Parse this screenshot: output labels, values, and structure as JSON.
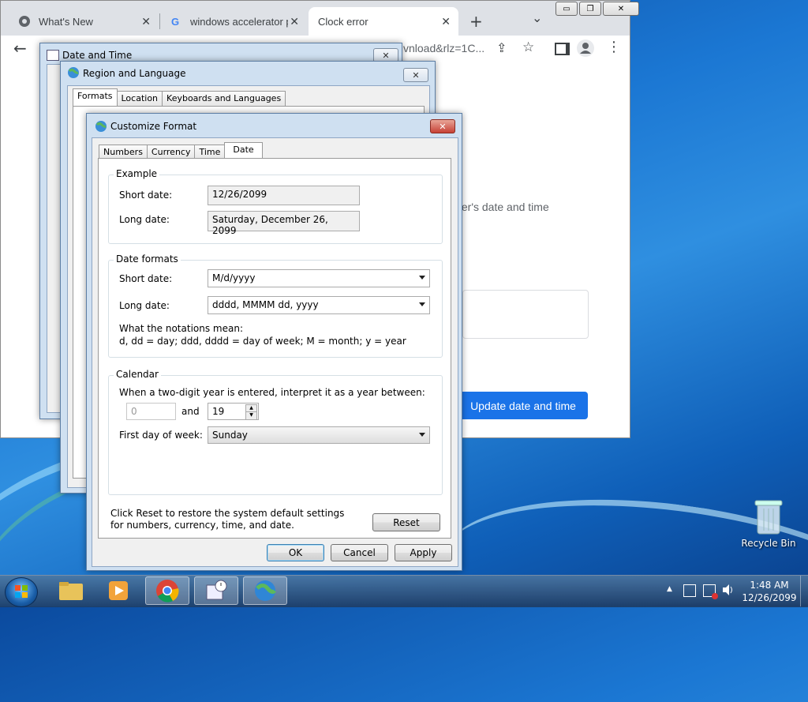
{
  "browser": {
    "tabs": [
      {
        "label": "What's New"
      },
      {
        "label": "windows accelerator pr"
      },
      {
        "label": "Clock error"
      }
    ],
    "address_fragment": "vnload&rlz=1C...",
    "body_text": "ter's date and time",
    "update_button": "Update date and time",
    "new_tab": "+",
    "tab_close": "✕",
    "tab_list": "⌄",
    "window_controls": {
      "minimize": "▭",
      "restore": "❐",
      "close": "✕"
    },
    "nav_back": "←",
    "share": "⇪",
    "star": "☆",
    "menu": "⋮"
  },
  "date_time_dialog": {
    "title": "Date and Time",
    "close": "✕"
  },
  "region_dialog": {
    "title": "Region and Language",
    "close": "✕",
    "tabs": [
      "Formats",
      "Location",
      "Keyboards and Languages"
    ]
  },
  "customize_dialog": {
    "title": "Customize Format",
    "close": "✕",
    "tabs": [
      "Numbers",
      "Currency",
      "Time",
      "Date"
    ],
    "example": {
      "group": "Example",
      "short_label": "Short date:",
      "short_value": "12/26/2099",
      "long_label": "Long date:",
      "long_value": "Saturday, December 26, 2099"
    },
    "formats": {
      "group": "Date formats",
      "short_label": "Short date:",
      "short_value": "M/d/yyyy",
      "long_label": "Long date:",
      "long_value": "dddd, MMMM dd, yyyy",
      "notation_title": "What the notations mean:",
      "notation_text": "d, dd = day;  ddd, dddd = day of week;  M = month;  y = year"
    },
    "calendar": {
      "group": "Calendar",
      "two_digit_text": "When a two-digit year is entered, interpret it as a year between:",
      "from_value": "0",
      "and_label": "and",
      "to_value": "19",
      "first_day_label": "First day of week:",
      "first_day_value": "Sunday"
    },
    "reset_text": "Click Reset to restore the system default settings for numbers, currency, time, and date.",
    "reset_button": "Reset",
    "ok_button": "OK",
    "cancel_button": "Cancel",
    "apply_button": "Apply"
  },
  "desktop": {
    "recycle_bin": "Recycle Bin"
  },
  "taskbar": {
    "time": "1:48 AM",
    "date": "12/26/2099",
    "tray_arrow": "▲"
  },
  "colors": {
    "chrome_blue": "#1a73e8",
    "dialog_close_red": "#c74135"
  }
}
